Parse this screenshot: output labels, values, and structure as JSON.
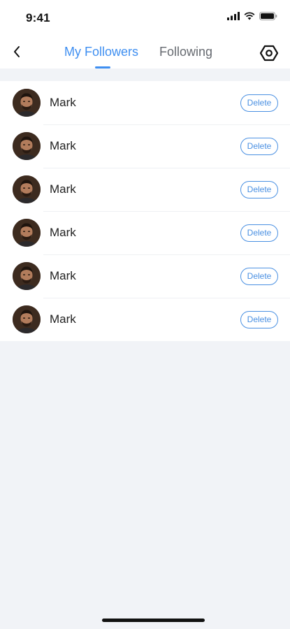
{
  "status_bar": {
    "time": "9:41"
  },
  "header": {
    "tabs": [
      {
        "label": "My Followers",
        "active": true
      },
      {
        "label": "Following",
        "active": false
      }
    ]
  },
  "followers": [
    {
      "name": "Mark",
      "action_label": "Delete"
    },
    {
      "name": "Mark",
      "action_label": "Delete"
    },
    {
      "name": "Mark",
      "action_label": "Delete"
    },
    {
      "name": "Mark",
      "action_label": "Delete"
    },
    {
      "name": "Mark",
      "action_label": "Delete"
    },
    {
      "name": "Mark",
      "action_label": "Delete"
    }
  ],
  "colors": {
    "accent": "#3f8ff1",
    "background": "#f1f3f7",
    "inactive_tab": "#666a70"
  },
  "icons": [
    "back-chevron-icon",
    "settings-icon",
    "signal-icon",
    "wifi-icon",
    "battery-icon"
  ]
}
